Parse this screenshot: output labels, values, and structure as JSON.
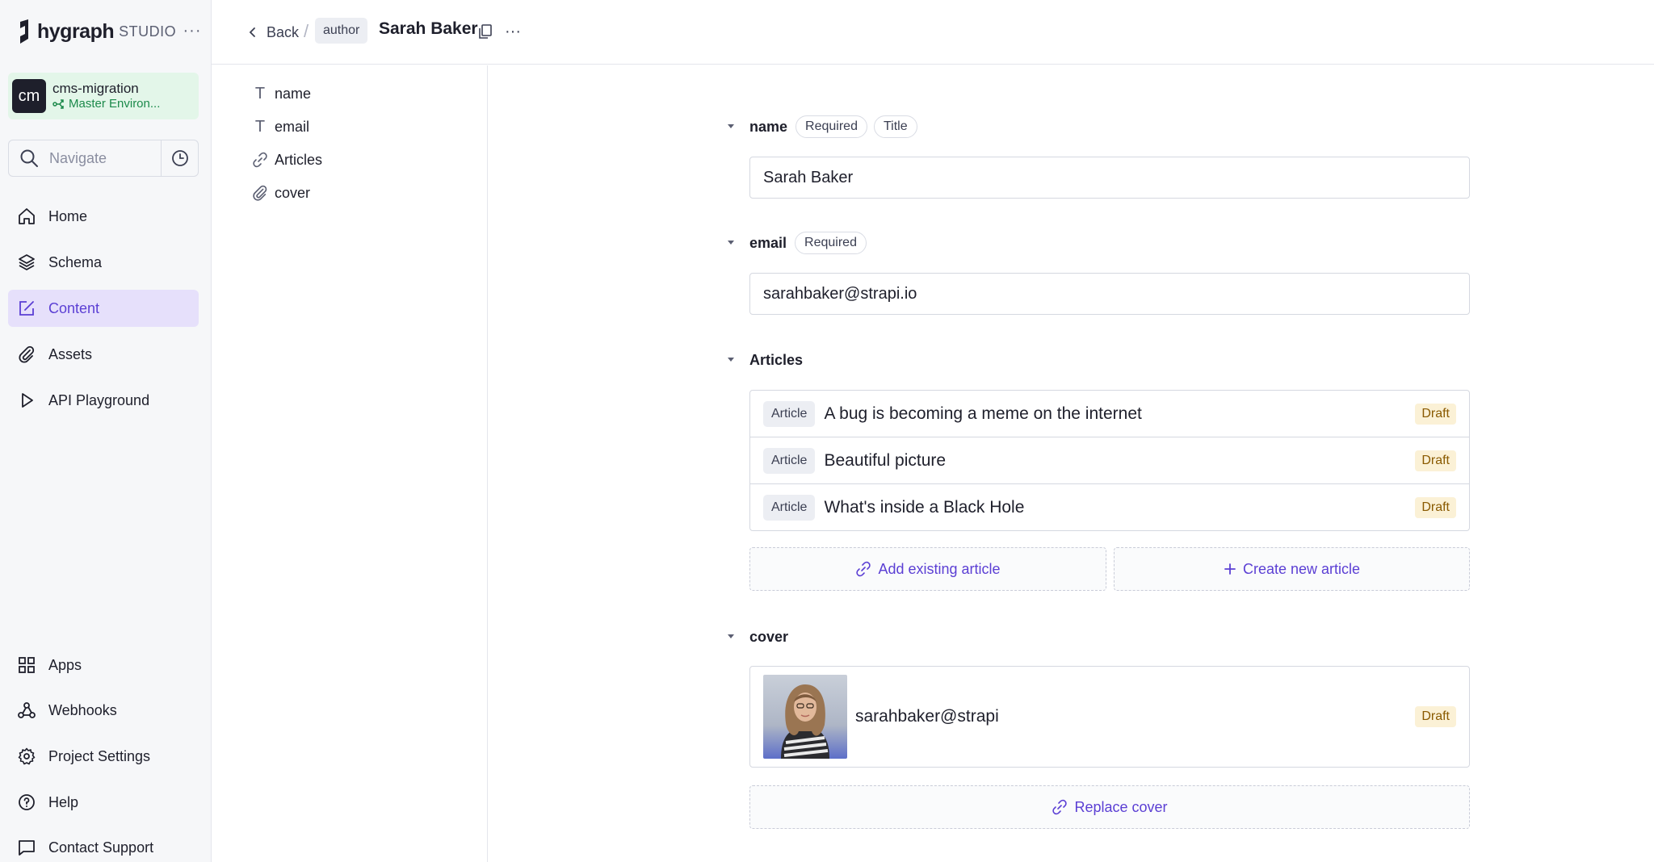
{
  "app": {
    "brand_name": "hygraph",
    "brand_suffix": "STUDIO"
  },
  "project": {
    "avatar_initials": "cm",
    "name": "cms-migration",
    "environment": "Master Environ..."
  },
  "navigate": {
    "placeholder": "Navigate"
  },
  "nav": {
    "home": "Home",
    "schema": "Schema",
    "content": "Content",
    "assets": "Assets",
    "api_playground": "API Playground",
    "apps": "Apps",
    "webhooks": "Webhooks",
    "project_settings": "Project Settings",
    "help": "Help",
    "contact_support": "Contact Support"
  },
  "header": {
    "back_label": "Back",
    "separator": "/",
    "model": "author",
    "entry_title": "Sarah Baker"
  },
  "outline": {
    "items": [
      "name",
      "email",
      "Articles",
      "cover"
    ]
  },
  "form": {
    "name": {
      "label": "name",
      "tags": [
        "Required",
        "Title"
      ],
      "value": "Sarah Baker"
    },
    "email": {
      "label": "email",
      "tags": [
        "Required"
      ],
      "value": "sarahbaker@strapi.io"
    },
    "articles": {
      "label": "Articles",
      "items": [
        {
          "type": "Article",
          "title": "A bug is becoming a meme on the internet",
          "status": "Draft"
        },
        {
          "type": "Article",
          "title": "Beautiful picture",
          "status": "Draft"
        },
        {
          "type": "Article",
          "title": "What's inside a Black Hole",
          "status": "Draft"
        }
      ],
      "add_existing_label": "Add existing article",
      "create_new_label": "Create new article"
    },
    "cover": {
      "label": "cover",
      "asset_name": "sarahbaker@strapi",
      "status": "Draft",
      "replace_label": "Replace cover"
    }
  },
  "colors": {
    "accent": "#5b3fd4",
    "active_nav_bg": "#e6e0fb",
    "env_green": "#1c8a4b",
    "draft_bg": "#fbf1d6",
    "draft_text": "#8a5a00"
  }
}
